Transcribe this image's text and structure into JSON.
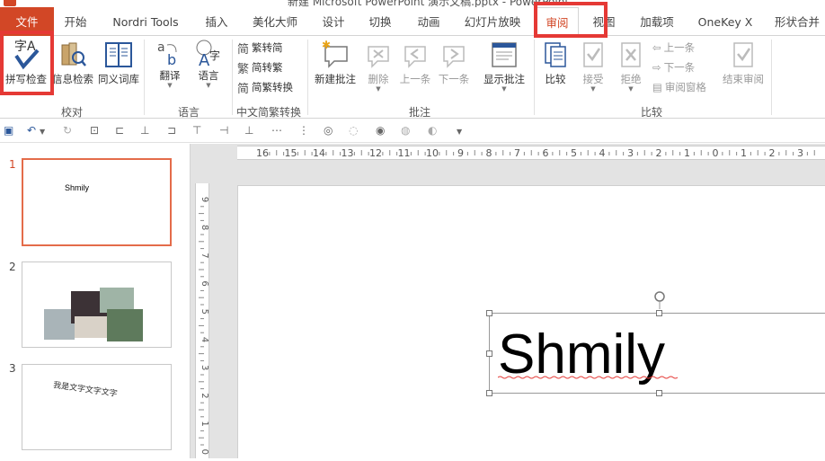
{
  "window": {
    "title": "新建 Microsoft PowerPoint 演示文稿.pptx - PowerPoint"
  },
  "tabs": [
    {
      "label": "文件"
    },
    {
      "label": "开始"
    },
    {
      "label": "Nordri Tools"
    },
    {
      "label": "插入"
    },
    {
      "label": "美化大师"
    },
    {
      "label": "设计"
    },
    {
      "label": "切换"
    },
    {
      "label": "动画"
    },
    {
      "label": "幻灯片放映"
    },
    {
      "label": "审阅"
    },
    {
      "label": "视图"
    },
    {
      "label": "加载项"
    },
    {
      "label": "OneKey X"
    },
    {
      "label": "形状合并"
    }
  ],
  "ribbon": {
    "proofing": {
      "spelling": "拼写检查",
      "research": "信息检索",
      "thesaurus": "同义词库",
      "group_label": "校对"
    },
    "language": {
      "translate": "翻译",
      "language": "语言",
      "group_label": "语言"
    },
    "chinese_conversion": {
      "to_simplified": "繁转简",
      "to_traditional": "简转繁",
      "conversion": "简繁转换",
      "group_label": "中文简繁转换"
    },
    "comments": {
      "new_comment": "新建批注",
      "delete": "删除",
      "previous": "上一条",
      "next": "下一条",
      "show_comments": "显示批注",
      "group_label": "批注"
    },
    "compare": {
      "compare": "比较",
      "accept": "接受",
      "reject": "拒绝",
      "previous": "上一条",
      "next": "下一条",
      "reviewing_pane": "审阅窗格",
      "end_review": "结束审阅",
      "group_label": "比较"
    }
  },
  "ruler": {
    "horizontal_labels": [
      "16",
      "15",
      "14",
      "13",
      "12",
      "11",
      "10",
      "9",
      "8",
      "7",
      "6",
      "5",
      "4",
      "3",
      "2",
      "1",
      "0",
      "1",
      "2",
      "3"
    ],
    "vertical_labels": [
      "9",
      "8",
      "7",
      "6",
      "5",
      "4",
      "3",
      "2",
      "1",
      "0"
    ]
  },
  "slides": [
    {
      "number": "1",
      "text": "Shmily"
    },
    {
      "number": "2",
      "text": ""
    },
    {
      "number": "3",
      "text": "我是文字文字文字"
    }
  ],
  "canvas": {
    "textbox_text": "Shmily"
  },
  "colors": {
    "accent": "#d24726",
    "highlight": "#e53935",
    "spell_check": "#2b579a"
  }
}
